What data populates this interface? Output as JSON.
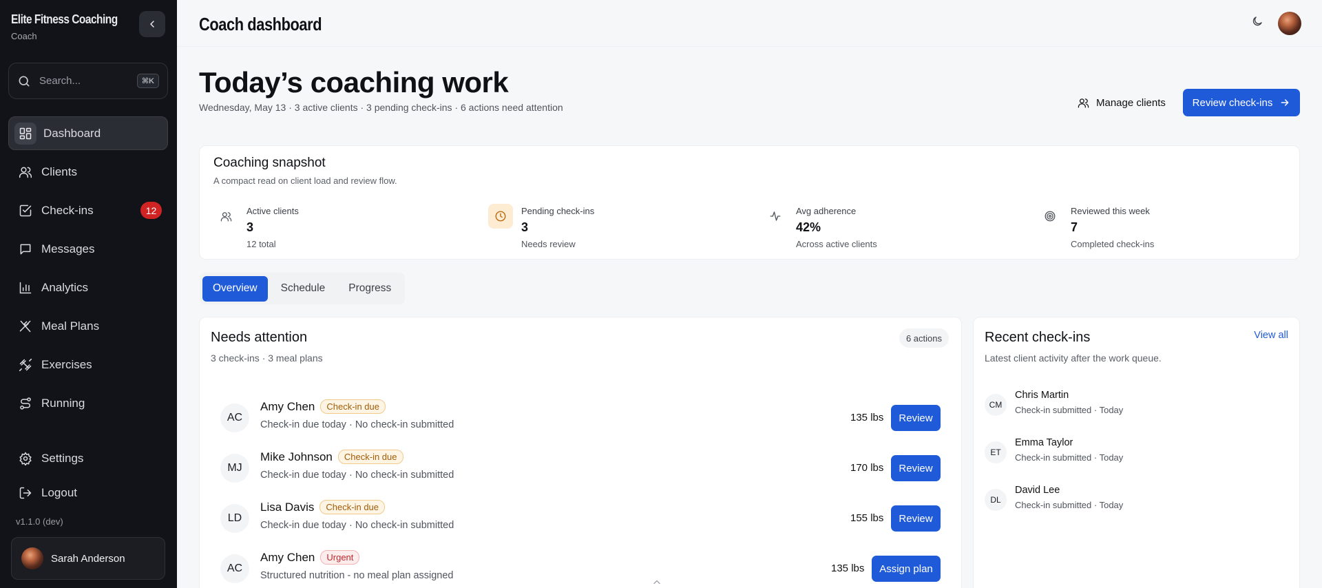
{
  "brand": {
    "name": "Elite Fitness Coaching",
    "role": "Coach"
  },
  "search": {
    "placeholder": "Search...",
    "shortcut": "⌘K"
  },
  "nav": {
    "items": [
      {
        "label": "Dashboard",
        "icon": "dashboard-icon",
        "active": true
      },
      {
        "label": "Clients",
        "icon": "users-icon"
      },
      {
        "label": "Check-ins",
        "icon": "checkbox-icon",
        "badge": "12"
      },
      {
        "label": "Messages",
        "icon": "message-icon"
      },
      {
        "label": "Analytics",
        "icon": "bar-chart-icon"
      },
      {
        "label": "Meal Plans",
        "icon": "utensils-icon"
      },
      {
        "label": "Exercises",
        "icon": "dumbbell-icon"
      },
      {
        "label": "Running",
        "icon": "route-icon"
      }
    ],
    "settings": "Settings",
    "logout": "Logout"
  },
  "version": "v1.1.0 (dev)",
  "user": {
    "name": "Sarah Anderson"
  },
  "topbar": {
    "title": "Coach dashboard"
  },
  "hero": {
    "title": "Today’s coaching work",
    "subtitle": "Wednesday, May 13 · 3 active clients · 3 pending check-ins · 6 actions need attention",
    "manage_label": "Manage clients",
    "review_label": "Review check-ins"
  },
  "snapshot": {
    "title": "Coaching snapshot",
    "subtitle": "A compact read on client load and review flow.",
    "stats": [
      {
        "label": "Active clients",
        "value": "3",
        "note": "12 total",
        "icon": "users-icon"
      },
      {
        "label": "Pending check-ins",
        "value": "3",
        "note": "Needs review",
        "icon": "clock-icon",
        "accent": "#fdecd2"
      },
      {
        "label": "Avg adherence",
        "value": "42%",
        "note": "Across active clients",
        "icon": "activity-icon"
      },
      {
        "label": "Reviewed this week",
        "value": "7",
        "note": "Completed check-ins",
        "icon": "target-icon"
      }
    ]
  },
  "tabs": [
    "Overview",
    "Schedule",
    "Progress"
  ],
  "needs_attention": {
    "title": "Needs attention",
    "subtitle": "3 check-ins · 3 meal plans",
    "count_chip": "6 actions",
    "rows": [
      {
        "initials": "AC",
        "name": "Amy Chen",
        "tag": "Check-in due",
        "detail": "Check-in due today · No check-in submitted",
        "weight": "135 lbs",
        "action": "Review"
      },
      {
        "initials": "MJ",
        "name": "Mike Johnson",
        "tag": "Check-in due",
        "detail": "Check-in due today · No check-in submitted",
        "weight": "170 lbs",
        "action": "Review"
      },
      {
        "initials": "LD",
        "name": "Lisa Davis",
        "tag": "Check-in due",
        "detail": "Check-in due today · No check-in submitted",
        "weight": "155 lbs",
        "action": "Review"
      },
      {
        "initials": "AC",
        "name": "Amy Chen",
        "tag": "Urgent",
        "detail": "Structured nutrition - no meal plan assigned",
        "weight": "135 lbs",
        "action": "Assign plan"
      }
    ]
  },
  "recent_checkins": {
    "title": "Recent check-ins",
    "subtitle": "Latest client activity after the work queue.",
    "view_all": "View all",
    "items": [
      {
        "initials": "CM",
        "name": "Chris Martin",
        "detail": "Check-in submitted · Today"
      },
      {
        "initials": "ET",
        "name": "Emma Taylor",
        "detail": "Check-in submitted · Today"
      },
      {
        "initials": "DL",
        "name": "David Lee",
        "detail": "Check-in submitted · Today"
      }
    ]
  },
  "colors": {
    "primary": "#1f5ad9",
    "sidebar": "#111318",
    "badge": "#d02424"
  }
}
